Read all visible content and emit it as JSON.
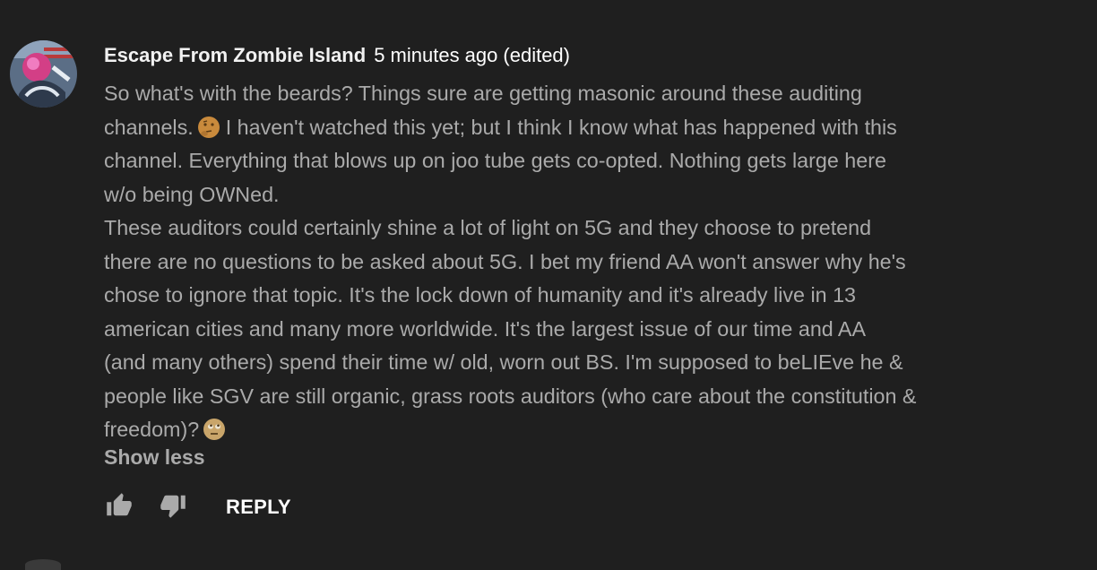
{
  "comment": {
    "author": "Escape From Zombie Island",
    "time": "5 minutes ago",
    "edited": "(edited)",
    "lines": [
      [
        "So what's with the beards?   Things sure are getting masonic around these auditing",
        null,
        ""
      ],
      [
        "channels.",
        "thinking-face-emoji",
        "I haven't watched this yet; but I think I know what has happened with this"
      ],
      [
        "channel. Everything that blows up on joo tube gets co-opted. Nothing gets large here",
        null,
        ""
      ],
      [
        "w/o being OWNed.",
        null,
        ""
      ],
      [
        "These auditors could certainly shine a lot of light on 5G and they choose to pretend",
        null,
        ""
      ],
      [
        "there are no questions to be asked about 5G. I bet my friend AA won't answer why he's",
        null,
        ""
      ],
      [
        "chose to ignore that topic. It's the lock down of humanity and it's already live in 13",
        null,
        ""
      ],
      [
        "american cities and many more worldwide. It's the largest issue of our time and AA",
        null,
        ""
      ],
      [
        "(and many others) spend their time w/ old, worn out BS. I'm supposed to beLIEve he &",
        null,
        ""
      ],
      [
        "people like SGV are still organic, grass roots auditors (who care about the constitution &",
        null,
        ""
      ],
      [
        "freedom)?",
        "eye-roll-emoji",
        ""
      ]
    ],
    "show_less": "Show less",
    "reply": "REPLY"
  },
  "icons": {
    "like": "thumb-up-icon",
    "dislike": "thumb-down-icon"
  },
  "colors": {
    "background": "#1f1f1f",
    "author": "#f1f1f1",
    "body_text": "#aaaaaa",
    "reply": "#ffffff"
  }
}
